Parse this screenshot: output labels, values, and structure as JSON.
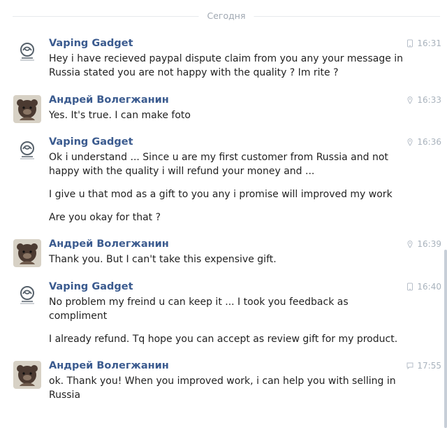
{
  "date_divider": "Сегодня",
  "messages": [
    {
      "author": "Vaping Gadget",
      "time": "16:31",
      "texts": [
        "Hey i have recieved paypal dispute claim from you any your message in Russia stated you are not happy with the quality ? Im rite ?"
      ]
    },
    {
      "author": "Андрей Волегжанин",
      "time": "16:33",
      "texts": [
        "Yes. It's true. I can make foto"
      ]
    },
    {
      "author": "Vaping Gadget",
      "time": "16:36",
      "texts": [
        "Ok i understand ... Since u are my first customer from Russia and not happy with the quality i will refund your money and ...",
        "I give u that mod as a gift to you any i promise will improved my work",
        "Are you okay for that ?"
      ]
    },
    {
      "author": "Андрей Волегжанин",
      "time": "16:39",
      "texts": [
        "Thank you. But I can't take this expensive gift."
      ]
    },
    {
      "author": "Vaping Gadget",
      "time": "16:40",
      "texts": [
        "No problem my freind u can keep it ... I took you feedback as compliment",
        "I already refund. Tq hope you can accept as review gift for my product."
      ]
    },
    {
      "author": "Андрей Волегжанин",
      "time": "17:55",
      "texts": [
        "ok. Thank you! When you improved work, i can help you with selling in Russia"
      ]
    }
  ],
  "icons": {
    "vaping_avatar": "vaping-gadget-logo-icon",
    "andrey_avatar": "bear-avatar-icon",
    "phone": "phone-icon",
    "location": "location-pin-icon",
    "chat": "chat-bubble-icon"
  },
  "colors": {
    "author": "#3b5b8f",
    "text": "#222222",
    "time": "#a9b3bd",
    "divider": "#e6e9ed",
    "scrollbar": "#c7ced8"
  }
}
